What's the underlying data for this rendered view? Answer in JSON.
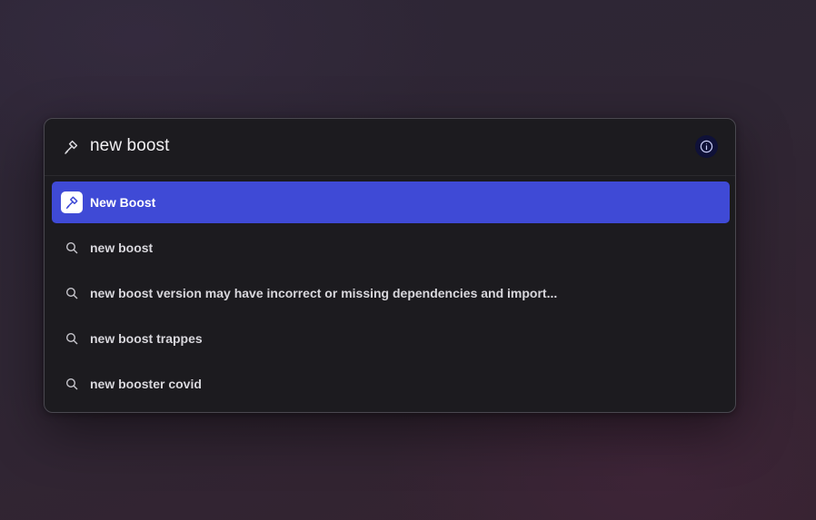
{
  "search": {
    "query": "new boost",
    "leading_icon": "hammer-icon",
    "info_icon": "info-icon"
  },
  "results": [
    {
      "label": "New Boost",
      "icon": "hammer-icon",
      "selected": true
    },
    {
      "label": "new boost",
      "icon": "search-icon",
      "selected": false
    },
    {
      "label": "new boost version may have incorrect or missing dependencies and import...",
      "icon": "search-icon",
      "selected": false
    },
    {
      "label": "new boost trappes",
      "icon": "search-icon",
      "selected": false
    },
    {
      "label": "new booster covid",
      "icon": "search-icon",
      "selected": false
    }
  ],
  "colors": {
    "selection": "#3f4ad6",
    "panel": "#1c1b1f",
    "info_button": "#0f1138"
  }
}
